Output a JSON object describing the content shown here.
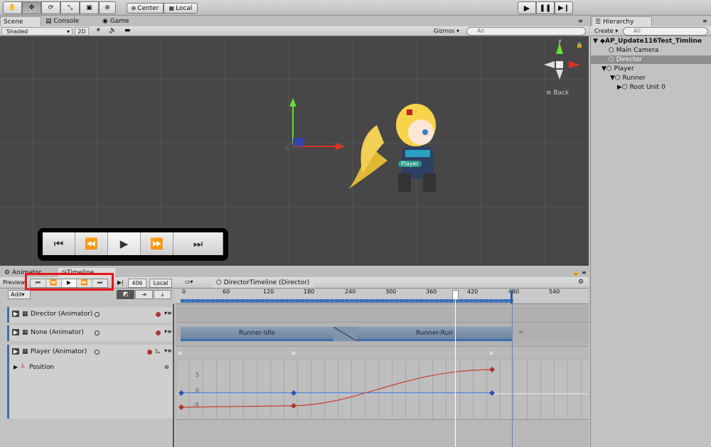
{
  "toolbar": {
    "pivot_label": "Center",
    "space_label": "Local",
    "tools": [
      "hand-icon",
      "move-icon",
      "rotate-icon",
      "scale-icon",
      "rect-icon",
      "transform-icon"
    ]
  },
  "scene": {
    "tab_scene": "Scene",
    "tab_console": "Console",
    "tab_game": "Game",
    "shading": "Shaded",
    "mode_2d": "2D",
    "gizmos": "Gizmos",
    "search_placeholder": "All",
    "gizmo_back": "Back",
    "gizmo_y": "y",
    "player_label": "Player"
  },
  "hierarchy": {
    "title": "Hierarchy",
    "create": "Create",
    "search_placeholder": "All",
    "items": [
      {
        "label": "AP_Update116Test_Timline",
        "depth": 0,
        "selected": false
      },
      {
        "label": "Main Camera",
        "depth": 1,
        "selected": false
      },
      {
        "label": "Director",
        "depth": 1,
        "selected": true
      },
      {
        "label": "Player",
        "depth": 1,
        "selected": false
      },
      {
        "label": "Runner",
        "depth": 2,
        "selected": false
      },
      {
        "label": "Root Unit 0",
        "depth": 3,
        "selected": false
      }
    ]
  },
  "timeline": {
    "tab_animator": "Animator",
    "tab_timeline": "Timeline",
    "preview": "Preview",
    "frame": "406",
    "space": "Local",
    "asset": "DirectorTimeline (Director)",
    "add": "Add",
    "ruler": [
      "0",
      "60",
      "120",
      "180",
      "240",
      "300",
      "360",
      "420",
      "480",
      "540"
    ],
    "tracks": [
      {
        "label": "Director (Animator)"
      },
      {
        "label": "None (Animator)"
      },
      {
        "label": "Player (Animator)"
      }
    ],
    "property": "Position",
    "clips": [
      "Runner-Idle",
      "Runner-Run"
    ],
    "curve_axis": [
      "5",
      "0",
      "-5"
    ]
  }
}
